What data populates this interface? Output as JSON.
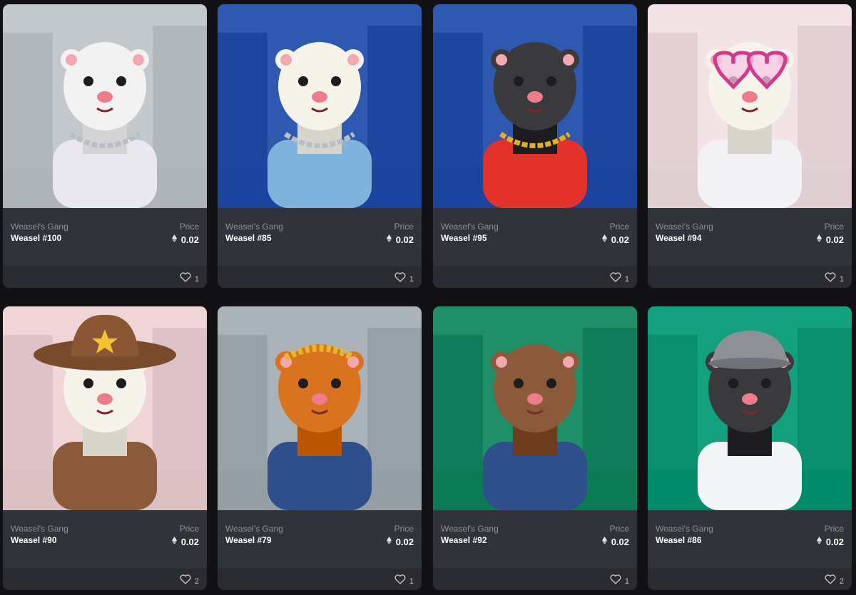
{
  "price_label": "Price",
  "icons": {
    "currency": "eth-icon",
    "like": "heart-icon"
  },
  "cards": [
    {
      "collection": "Weasel's Gang",
      "name": "Weasel #100",
      "price": "0.02",
      "likes": "1",
      "bg": "#c2c8cc",
      "fur": "#f2f2f2",
      "outfit": "#e8e8ee",
      "accessory": "chain"
    },
    {
      "collection": "Weasel's Gang",
      "name": "Weasel #85",
      "price": "0.02",
      "likes": "1",
      "bg": "#2f58b0",
      "fur": "#f6f3ea",
      "outfit": "#7fb3dc",
      "accessory": "chain"
    },
    {
      "collection": "Weasel's Gang",
      "name": "Weasel #95",
      "price": "0.02",
      "likes": "1",
      "bg": "#2f58b0",
      "fur": "#3a3a3d",
      "outfit": "#e2322a",
      "accessory": "gold-chain"
    },
    {
      "collection": "Weasel's Gang",
      "name": "Weasel #94",
      "price": "0.02",
      "likes": "1",
      "bg": "#f4e3e6",
      "fur": "#f6f3ea",
      "outfit": "#f2f2f5",
      "accessory": "heart-glasses"
    },
    {
      "collection": "Weasel's Gang",
      "name": "Weasel #90",
      "price": "0.02",
      "likes": "2",
      "bg": "#efd5d8",
      "fur": "#f6f3ea",
      "outfit": "#8a5a3a",
      "accessory": "cowboy-hat"
    },
    {
      "collection": "Weasel's Gang",
      "name": "Weasel #79",
      "price": "0.02",
      "likes": "1",
      "bg": "#a9b3b9",
      "fur": "#d9731f",
      "outfit": "#2f4f8c",
      "accessory": "laurel"
    },
    {
      "collection": "Weasel's Gang",
      "name": "Weasel #92",
      "price": "0.02",
      "likes": "1",
      "bg": "#1f8f6a",
      "fur": "#8a5a3a",
      "outfit": "#2f4f8c",
      "accessory": "none"
    },
    {
      "collection": "Weasel's Gang",
      "name": "Weasel #86",
      "price": "0.02",
      "likes": "2",
      "bg": "#13a07e",
      "fur": "#3a3a3d",
      "outfit": "#f2f4f6",
      "accessory": "cap"
    }
  ]
}
